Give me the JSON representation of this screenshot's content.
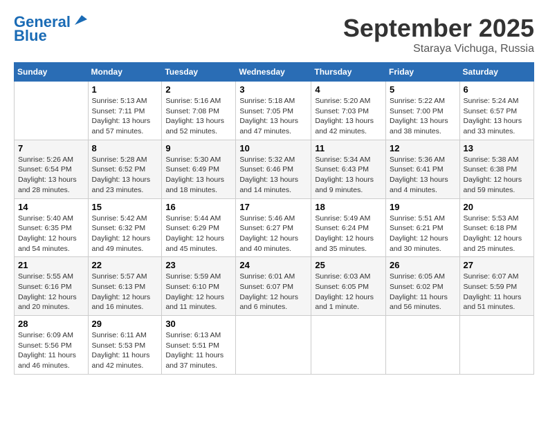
{
  "header": {
    "logo_line1": "General",
    "logo_line2": "Blue",
    "month": "September 2025",
    "location": "Staraya Vichuga, Russia"
  },
  "weekdays": [
    "Sunday",
    "Monday",
    "Tuesday",
    "Wednesday",
    "Thursday",
    "Friday",
    "Saturday"
  ],
  "weeks": [
    [
      {
        "day": "",
        "info": ""
      },
      {
        "day": "1",
        "info": "Sunrise: 5:13 AM\nSunset: 7:11 PM\nDaylight: 13 hours\nand 57 minutes."
      },
      {
        "day": "2",
        "info": "Sunrise: 5:16 AM\nSunset: 7:08 PM\nDaylight: 13 hours\nand 52 minutes."
      },
      {
        "day": "3",
        "info": "Sunrise: 5:18 AM\nSunset: 7:05 PM\nDaylight: 13 hours\nand 47 minutes."
      },
      {
        "day": "4",
        "info": "Sunrise: 5:20 AM\nSunset: 7:03 PM\nDaylight: 13 hours\nand 42 minutes."
      },
      {
        "day": "5",
        "info": "Sunrise: 5:22 AM\nSunset: 7:00 PM\nDaylight: 13 hours\nand 38 minutes."
      },
      {
        "day": "6",
        "info": "Sunrise: 5:24 AM\nSunset: 6:57 PM\nDaylight: 13 hours\nand 33 minutes."
      }
    ],
    [
      {
        "day": "7",
        "info": "Sunrise: 5:26 AM\nSunset: 6:54 PM\nDaylight: 13 hours\nand 28 minutes."
      },
      {
        "day": "8",
        "info": "Sunrise: 5:28 AM\nSunset: 6:52 PM\nDaylight: 13 hours\nand 23 minutes."
      },
      {
        "day": "9",
        "info": "Sunrise: 5:30 AM\nSunset: 6:49 PM\nDaylight: 13 hours\nand 18 minutes."
      },
      {
        "day": "10",
        "info": "Sunrise: 5:32 AM\nSunset: 6:46 PM\nDaylight: 13 hours\nand 14 minutes."
      },
      {
        "day": "11",
        "info": "Sunrise: 5:34 AM\nSunset: 6:43 PM\nDaylight: 13 hours\nand 9 minutes."
      },
      {
        "day": "12",
        "info": "Sunrise: 5:36 AM\nSunset: 6:41 PM\nDaylight: 13 hours\nand 4 minutes."
      },
      {
        "day": "13",
        "info": "Sunrise: 5:38 AM\nSunset: 6:38 PM\nDaylight: 12 hours\nand 59 minutes."
      }
    ],
    [
      {
        "day": "14",
        "info": "Sunrise: 5:40 AM\nSunset: 6:35 PM\nDaylight: 12 hours\nand 54 minutes."
      },
      {
        "day": "15",
        "info": "Sunrise: 5:42 AM\nSunset: 6:32 PM\nDaylight: 12 hours\nand 49 minutes."
      },
      {
        "day": "16",
        "info": "Sunrise: 5:44 AM\nSunset: 6:29 PM\nDaylight: 12 hours\nand 45 minutes."
      },
      {
        "day": "17",
        "info": "Sunrise: 5:46 AM\nSunset: 6:27 PM\nDaylight: 12 hours\nand 40 minutes."
      },
      {
        "day": "18",
        "info": "Sunrise: 5:49 AM\nSunset: 6:24 PM\nDaylight: 12 hours\nand 35 minutes."
      },
      {
        "day": "19",
        "info": "Sunrise: 5:51 AM\nSunset: 6:21 PM\nDaylight: 12 hours\nand 30 minutes."
      },
      {
        "day": "20",
        "info": "Sunrise: 5:53 AM\nSunset: 6:18 PM\nDaylight: 12 hours\nand 25 minutes."
      }
    ],
    [
      {
        "day": "21",
        "info": "Sunrise: 5:55 AM\nSunset: 6:16 PM\nDaylight: 12 hours\nand 20 minutes."
      },
      {
        "day": "22",
        "info": "Sunrise: 5:57 AM\nSunset: 6:13 PM\nDaylight: 12 hours\nand 16 minutes."
      },
      {
        "day": "23",
        "info": "Sunrise: 5:59 AM\nSunset: 6:10 PM\nDaylight: 12 hours\nand 11 minutes."
      },
      {
        "day": "24",
        "info": "Sunrise: 6:01 AM\nSunset: 6:07 PM\nDaylight: 12 hours\nand 6 minutes."
      },
      {
        "day": "25",
        "info": "Sunrise: 6:03 AM\nSunset: 6:05 PM\nDaylight: 12 hours\nand 1 minute."
      },
      {
        "day": "26",
        "info": "Sunrise: 6:05 AM\nSunset: 6:02 PM\nDaylight: 11 hours\nand 56 minutes."
      },
      {
        "day": "27",
        "info": "Sunrise: 6:07 AM\nSunset: 5:59 PM\nDaylight: 11 hours\nand 51 minutes."
      }
    ],
    [
      {
        "day": "28",
        "info": "Sunrise: 6:09 AM\nSunset: 5:56 PM\nDaylight: 11 hours\nand 46 minutes."
      },
      {
        "day": "29",
        "info": "Sunrise: 6:11 AM\nSunset: 5:53 PM\nDaylight: 11 hours\nand 42 minutes."
      },
      {
        "day": "30",
        "info": "Sunrise: 6:13 AM\nSunset: 5:51 PM\nDaylight: 11 hours\nand 37 minutes."
      },
      {
        "day": "",
        "info": ""
      },
      {
        "day": "",
        "info": ""
      },
      {
        "day": "",
        "info": ""
      },
      {
        "day": "",
        "info": ""
      }
    ]
  ]
}
